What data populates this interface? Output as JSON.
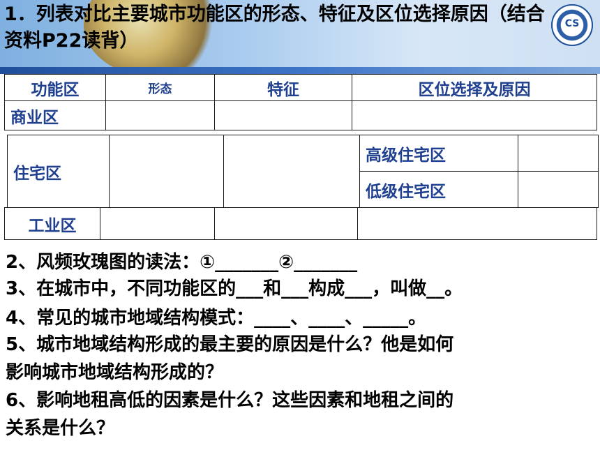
{
  "title": "1．列表对比主要城市功能区的形态、特征及区位选择原因（结合资料P22读背）",
  "logo_text": "CS",
  "table_top": {
    "headers": [
      "功能区",
      "形态",
      "特征",
      "区位选择及原因"
    ],
    "row_commercial": "商业区"
  },
  "table_residential": {
    "label": "住宅区",
    "high": "高级住宅区",
    "low": "低级住宅区"
  },
  "table_industrial": {
    "label": "工业区"
  },
  "questions": [
    "2、风频玫瑰图的读法：①_______②_______",
    "3、在城市中，不同功能区的___和___构成___，叫做__。",
    "4、常见的城市地域结构模式：____、____、_____。",
    "5、城市地域结构形成的最主要的原因是什么？他是如何",
    "影响城市地域结构形成的？",
    "6、影响地租高低的因素是什么？这些因素和地租之间的",
    "关系是什么？"
  ]
}
